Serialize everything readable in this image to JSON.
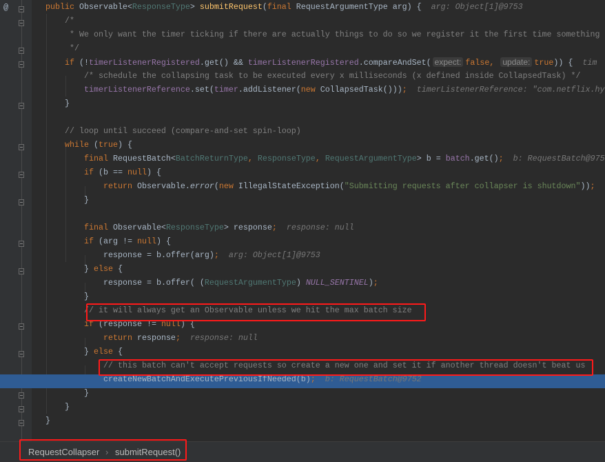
{
  "editor": {
    "gutter_marker": "@",
    "highlight_color": "#2f5c94",
    "lines": [
      {
        "level": 0,
        "tokens": [
          {
            "c": "kw",
            "t": "public "
          },
          {
            "c": "",
            "t": "Observable<"
          },
          {
            "c": "tp",
            "t": "ResponseType"
          },
          {
            "c": "",
            "t": "> "
          },
          {
            "c": "fn",
            "t": "submitRequest"
          },
          {
            "c": "",
            "t": "("
          },
          {
            "c": "kw",
            "t": "final "
          },
          {
            "c": "",
            "t": "RequestArgumentType arg) {"
          },
          {
            "c": "hint",
            "t": "arg: Object[1]@9753"
          }
        ]
      },
      {
        "level": 1,
        "tokens": [
          {
            "c": "cm",
            "t": "/*"
          }
        ]
      },
      {
        "level": 1,
        "tokens": [
          {
            "c": "cm",
            "t": " * We only want the timer ticking if there are actually things to do so we register it the first time something"
          }
        ]
      },
      {
        "level": 1,
        "tokens": [
          {
            "c": "cm",
            "t": " */"
          }
        ]
      },
      {
        "level": 1,
        "tokens": [
          {
            "c": "kw",
            "t": "if "
          },
          {
            "c": "",
            "t": "(!"
          },
          {
            "c": "fd",
            "t": "timerListenerRegistered"
          },
          {
            "c": "",
            "t": ".get() && "
          },
          {
            "c": "fd",
            "t": "timerListenerRegistered"
          },
          {
            "c": "",
            "t": ".compareAndSet("
          },
          {
            "c": "ph",
            "t": "expect:"
          },
          {
            "c": "kw",
            "t": "false, "
          },
          {
            "c": "ph",
            "t": "update:"
          },
          {
            "c": "kw",
            "t": "true"
          },
          {
            "c": "",
            "t": ")) {"
          },
          {
            "c": "hint",
            "t": "tim"
          }
        ]
      },
      {
        "level": 2,
        "tokens": [
          {
            "c": "cm",
            "t": "/* schedule the collapsing task to be executed every x milliseconds (x defined inside CollapsedTask) */"
          }
        ]
      },
      {
        "level": 2,
        "tokens": [
          {
            "c": "fd",
            "t": "timerListenerReference"
          },
          {
            "c": "",
            "t": ".set("
          },
          {
            "c": "fd",
            "t": "timer"
          },
          {
            "c": "",
            "t": ".addListener("
          },
          {
            "c": "kw",
            "t": "new "
          },
          {
            "c": "",
            "t": "CollapsedTask()))"
          },
          {
            "c": "kw",
            "t": ";"
          },
          {
            "c": "hint",
            "t": "timerListenerReference: \"com.netflix.hy"
          }
        ]
      },
      {
        "level": 1,
        "tokens": [
          {
            "c": "",
            "t": "}"
          }
        ]
      },
      {
        "level": 0,
        "tokens": []
      },
      {
        "level": 1,
        "tokens": [
          {
            "c": "cm",
            "t": "// loop until succeed (compare-and-set spin-loop)"
          }
        ]
      },
      {
        "level": 1,
        "tokens": [
          {
            "c": "kw",
            "t": "while "
          },
          {
            "c": "",
            "t": "("
          },
          {
            "c": "kw",
            "t": "true"
          },
          {
            "c": "",
            "t": ") {"
          }
        ]
      },
      {
        "level": 2,
        "tokens": [
          {
            "c": "kw",
            "t": "final "
          },
          {
            "c": "",
            "t": "RequestBatch<"
          },
          {
            "c": "tp",
            "t": "BatchReturnType"
          },
          {
            "c": "kw",
            "t": ", "
          },
          {
            "c": "tp",
            "t": "ResponseType"
          },
          {
            "c": "kw",
            "t": ", "
          },
          {
            "c": "tp",
            "t": "RequestArgumentType"
          },
          {
            "c": "",
            "t": "> b = "
          },
          {
            "c": "fd",
            "t": "batch"
          },
          {
            "c": "",
            "t": ".get()"
          },
          {
            "c": "kw",
            "t": ";"
          },
          {
            "c": "hint",
            "t": "b: RequestBatch@975"
          }
        ]
      },
      {
        "level": 2,
        "tokens": [
          {
            "c": "kw",
            "t": "if "
          },
          {
            "c": "",
            "t": "(b == "
          },
          {
            "c": "kw",
            "t": "null"
          },
          {
            "c": "",
            "t": ") {"
          }
        ]
      },
      {
        "level": 3,
        "tokens": [
          {
            "c": "kw",
            "t": "return "
          },
          {
            "c": "",
            "t": "Observable."
          },
          {
            "c": "it",
            "t": "error"
          },
          {
            "c": "",
            "t": "("
          },
          {
            "c": "kw",
            "t": "new "
          },
          {
            "c": "",
            "t": "IllegalStateException("
          },
          {
            "c": "str",
            "t": "\"Submitting requests after collapser is shutdown\""
          },
          {
            "c": "",
            "t": "))"
          },
          {
            "c": "kw",
            "t": ";"
          }
        ]
      },
      {
        "level": 2,
        "tokens": [
          {
            "c": "",
            "t": "}"
          }
        ]
      },
      {
        "level": 0,
        "tokens": []
      },
      {
        "level": 2,
        "tokens": [
          {
            "c": "kw",
            "t": "final "
          },
          {
            "c": "",
            "t": "Observable<"
          },
          {
            "c": "tp",
            "t": "ResponseType"
          },
          {
            "c": "",
            "t": "> response"
          },
          {
            "c": "kw",
            "t": ";"
          },
          {
            "c": "hint",
            "t": "response: null"
          }
        ]
      },
      {
        "level": 2,
        "tokens": [
          {
            "c": "kw",
            "t": "if "
          },
          {
            "c": "",
            "t": "(arg != "
          },
          {
            "c": "kw",
            "t": "null"
          },
          {
            "c": "",
            "t": ") {"
          }
        ]
      },
      {
        "level": 3,
        "tokens": [
          {
            "c": "",
            "t": "response = b.offer(arg)"
          },
          {
            "c": "kw",
            "t": ";"
          },
          {
            "c": "hint",
            "t": "arg: Object[1]@9753"
          }
        ]
      },
      {
        "level": 2,
        "tokens": [
          {
            "c": "",
            "t": "} "
          },
          {
            "c": "kw",
            "t": "else "
          },
          {
            "c": "",
            "t": "{"
          }
        ]
      },
      {
        "level": 3,
        "tokens": [
          {
            "c": "",
            "t": "response = b.offer( ("
          },
          {
            "c": "tp",
            "t": "RequestArgumentType"
          },
          {
            "c": "",
            "t": ") "
          },
          {
            "c": "const",
            "t": "NULL_SENTINEL"
          },
          {
            "c": "",
            "t": ")"
          },
          {
            "c": "kw",
            "t": ";"
          }
        ]
      },
      {
        "level": 2,
        "tokens": [
          {
            "c": "",
            "t": "}"
          }
        ]
      },
      {
        "level": 2,
        "tokens": [
          {
            "c": "cm",
            "t": "// it will always get an Observable unless we hit the max batch size"
          }
        ]
      },
      {
        "level": 2,
        "tokens": [
          {
            "c": "kw",
            "t": "if "
          },
          {
            "c": "",
            "t": "(response != "
          },
          {
            "c": "kw",
            "t": "null"
          },
          {
            "c": "",
            "t": ") {"
          }
        ]
      },
      {
        "level": 3,
        "tokens": [
          {
            "c": "kw",
            "t": "return "
          },
          {
            "c": "",
            "t": "response"
          },
          {
            "c": "kw",
            "t": ";"
          },
          {
            "c": "hint",
            "t": "response: null"
          }
        ]
      },
      {
        "level": 2,
        "tokens": [
          {
            "c": "",
            "t": "} "
          },
          {
            "c": "kw",
            "t": "else "
          },
          {
            "c": "",
            "t": "{"
          }
        ]
      },
      {
        "level": 3,
        "tokens": [
          {
            "c": "cm",
            "t": "// this batch can't accept requests so create a new one and set it if another thread doesn't beat us"
          }
        ]
      },
      {
        "level": 3,
        "current": true,
        "tokens": [
          {
            "c": "",
            "t": "createNewBatchAndExecutePreviousIfNeeded(b)"
          },
          {
            "c": "kw",
            "t": ";"
          },
          {
            "c": "hint",
            "t": "b: RequestBatch@9752"
          }
        ]
      },
      {
        "level": 2,
        "tokens": [
          {
            "c": "",
            "t": "}"
          }
        ]
      },
      {
        "level": 1,
        "tokens": [
          {
            "c": "",
            "t": "}"
          }
        ]
      },
      {
        "level": 0,
        "tokens": [
          {
            "c": "",
            "t": "}"
          }
        ]
      }
    ]
  },
  "breadcrumb": {
    "items": [
      "RequestCollapser",
      "submitRequest()"
    ],
    "separator": "›"
  },
  "annotation_color": "#ff1a1a"
}
